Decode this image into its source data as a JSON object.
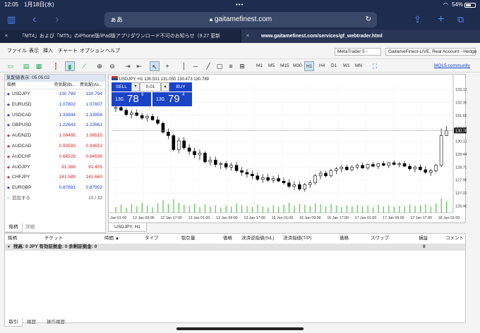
{
  "status_bar": {
    "time": "12:05",
    "date": "1月18日(水)",
    "battery": "54%"
  },
  "safari": {
    "aa": "ぁあ",
    "url": "gaitamefinest.com"
  },
  "tabs": [
    {
      "label": "「MT4」および「MT5」のiPhone版/iPad版アプリダウンロード不可のお知らせ（9.27 更新"
    },
    {
      "label": "www.gaitamefinest.com/services/gf_webtrader.html"
    }
  ],
  "menu": {
    "items": [
      "ファイル",
      "表示",
      "挿入",
      "チャート",
      "オプション",
      "ヘルプ"
    ]
  },
  "platform_select": "MetaTrader 5 -",
  "account_select": "GaitameFinest-LIVE, Real Account - Hedge",
  "toolbar": {
    "timeframes": [
      "M1",
      "M5",
      "M15",
      "M30",
      "H1",
      "H4",
      "D1",
      "W1",
      "MN"
    ],
    "active_timeframe": "H1",
    "mql5_link": "MQL5.community"
  },
  "market_watch": {
    "title": "気配値表示: 05:05:02",
    "headers": [
      "銘柄",
      "売気配(Bi...",
      "買気配(As..."
    ],
    "rows": [
      {
        "symbol": "USDJPY",
        "bid": "130.789",
        "ask": "130.794",
        "color": "#1a3fcc"
      },
      {
        "symbol": "EURUSD",
        "bid": "1.07802",
        "ask": "1.07807",
        "color": "#1a3fcc"
      },
      {
        "symbol": "USDCAD",
        "bid": "1.33944",
        "ask": "1.33956",
        "color": "#1a3fcc"
      },
      {
        "symbol": "GBPUSD",
        "bid": "1.22643",
        "ask": "1.22661",
        "color": "#1a3fcc"
      },
      {
        "symbol": "AUDNZD",
        "bid": "1.08495",
        "ask": "1.08515",
        "color": "#d62020"
      },
      {
        "symbol": "AUDCAD",
        "bid": "0.93593",
        "ask": "0.93613",
        "color": "#d62020"
      },
      {
        "symbol": "AUDCHF",
        "bid": "0.64528",
        "ask": "0.64536",
        "color": "#d62020"
      },
      {
        "symbol": "AUDJPY",
        "bid": "91.388",
        "ask": "91.405",
        "color": "#d62020"
      },
      {
        "symbol": "CHFJPY",
        "bid": "141.589",
        "ask": "141.660",
        "color": "#d62020"
      },
      {
        "symbol": "EURGBP",
        "bid": "0.87891",
        "ask": "0.87902",
        "color": "#1a3fcc"
      }
    ],
    "add_label": "追加する",
    "count": "10 / 32",
    "tabs": [
      "銘柄",
      "詳細"
    ]
  },
  "chart": {
    "header": "USDJPY, H1",
    "ohlc": "130.531 131.050 130.473 130.789",
    "tab": "USDJPY, H1",
    "trade": {
      "sell_label": "SELL",
      "buy_label": "BUY",
      "volume": "0.01",
      "sell_big": "130.",
      "sell_digits": "78",
      "sell_sup": "9",
      "buy_big": "130.",
      "buy_digits": "79",
      "buy_sup": "4"
    },
    "current_price": "130.789",
    "y_ticks": [
      "133.138",
      "132.398",
      "131.658",
      "130.918",
      "130.179",
      "129.440",
      "128.700",
      "127.961",
      "127.221",
      "126.481"
    ],
    "x_ticks": [
      "12 Jan 01:00",
      "12 Jan 09:00",
      "12 Jan 17:00",
      "13 Jan 01:00",
      "13 Jan 09:00",
      "13 Jan 17:00",
      "16 Jan 01:00",
      "16 Jan 09:00",
      "16 Jan 17:00",
      "17 Jan 01:00",
      "17 Jan 09:00",
      "17 Jan 17:00",
      "18 Jan 01:00"
    ],
    "price_range": [
      126.1,
      133.5
    ],
    "candles": [
      [
        132.05,
        132.25,
        131.85,
        132.1
      ],
      [
        132.1,
        132.3,
        131.9,
        131.95
      ],
      [
        131.95,
        132.1,
        131.6,
        131.7
      ],
      [
        131.7,
        131.95,
        131.5,
        131.8
      ],
      [
        131.8,
        132.0,
        131.6,
        131.65
      ],
      [
        131.65,
        131.8,
        131.4,
        131.5
      ],
      [
        131.5,
        131.7,
        131.3,
        131.6
      ],
      [
        131.6,
        131.75,
        131.35,
        131.4
      ],
      [
        131.4,
        131.6,
        131.1,
        131.2
      ],
      [
        131.2,
        131.3,
        130.6,
        130.7
      ],
      [
        130.7,
        130.9,
        130.3,
        130.5
      ],
      [
        130.5,
        130.6,
        129.6,
        129.7
      ],
      [
        129.7,
        130.4,
        129.5,
        130.2
      ],
      [
        130.2,
        130.4,
        129.7,
        129.8
      ],
      [
        129.8,
        130.0,
        129.4,
        129.6
      ],
      [
        129.6,
        129.8,
        129.2,
        129.4
      ],
      [
        129.4,
        129.7,
        129.1,
        129.5
      ],
      [
        129.5,
        129.6,
        128.9,
        129.0
      ],
      [
        129.0,
        129.3,
        128.8,
        129.1
      ],
      [
        129.1,
        129.3,
        128.7,
        128.85
      ],
      [
        128.85,
        129.0,
        128.6,
        128.9
      ],
      [
        128.9,
        129.05,
        128.55,
        128.7
      ],
      [
        128.7,
        128.95,
        128.5,
        128.8
      ],
      [
        128.8,
        129.0,
        128.4,
        128.5
      ],
      [
        128.5,
        128.7,
        128.2,
        128.4
      ],
      [
        128.4,
        128.6,
        128.1,
        128.3
      ],
      [
        128.3,
        128.5,
        128.0,
        128.2
      ],
      [
        128.2,
        128.4,
        127.9,
        128.0
      ],
      [
        128.0,
        128.3,
        127.8,
        128.1
      ],
      [
        128.1,
        128.3,
        127.85,
        127.95
      ],
      [
        127.95,
        128.2,
        127.8,
        128.05
      ],
      [
        128.05,
        128.25,
        127.85,
        127.9
      ],
      [
        127.9,
        128.1,
        127.7,
        127.8
      ],
      [
        127.8,
        128.0,
        127.5,
        127.6
      ],
      [
        127.6,
        127.9,
        127.4,
        127.7
      ],
      [
        127.7,
        127.9,
        127.35,
        127.45
      ],
      [
        127.45,
        127.8,
        127.3,
        127.7
      ],
      [
        127.7,
        127.95,
        127.5,
        127.8
      ],
      [
        127.8,
        128.3,
        127.7,
        128.2
      ],
      [
        128.2,
        128.5,
        128.0,
        128.35
      ],
      [
        128.35,
        128.5,
        128.1,
        128.2
      ],
      [
        128.2,
        128.6,
        128.1,
        128.5
      ],
      [
        128.5,
        128.7,
        128.3,
        128.6
      ],
      [
        128.6,
        128.8,
        128.4,
        128.7
      ],
      [
        128.7,
        128.85,
        128.5,
        128.55
      ],
      [
        128.55,
        128.8,
        128.45,
        128.7
      ],
      [
        128.7,
        128.9,
        128.55,
        128.8
      ],
      [
        128.8,
        128.95,
        128.6,
        128.65
      ],
      [
        128.65,
        128.9,
        128.55,
        128.85
      ],
      [
        128.85,
        129.0,
        128.7,
        128.75
      ],
      [
        128.75,
        128.95,
        128.6,
        128.9
      ],
      [
        128.9,
        129.05,
        128.75,
        128.8
      ],
      [
        128.8,
        129.0,
        128.65,
        128.95
      ],
      [
        128.95,
        129.1,
        128.8,
        128.85
      ],
      [
        128.85,
        129.0,
        128.7,
        128.9
      ],
      [
        128.9,
        129.05,
        128.7,
        128.75
      ],
      [
        128.75,
        128.9,
        128.5,
        128.6
      ],
      [
        128.6,
        128.8,
        128.4,
        128.7
      ],
      [
        128.7,
        128.85,
        128.5,
        128.55
      ],
      [
        128.55,
        128.75,
        128.3,
        128.4
      ],
      [
        128.4,
        128.6,
        128.2,
        128.5
      ],
      [
        128.5,
        128.9,
        128.4,
        128.8
      ],
      [
        128.8,
        130.9,
        128.7,
        130.5
      ],
      [
        130.5,
        131.05,
        130.47,
        130.789
      ]
    ],
    "volumes": [
      40,
      55,
      35,
      60,
      45,
      70,
      50,
      38,
      65,
      90,
      60,
      95,
      70,
      55,
      48,
      62,
      40,
      58,
      44,
      52,
      36,
      48,
      42,
      66,
      50,
      46,
      40,
      58,
      44,
      38,
      50,
      42,
      56,
      70,
      48,
      60,
      54,
      46,
      68,
      58,
      44,
      62,
      50,
      40,
      52,
      46,
      56,
      42,
      48,
      38,
      54,
      44,
      50,
      40,
      46,
      42,
      58,
      48,
      52,
      60,
      44,
      66,
      100,
      80
    ]
  },
  "terminal": {
    "headers": [
      "銘柄",
      "チケット",
      "時間 ▲",
      "タイプ",
      "取引量",
      "価格",
      "決済逆指値(S/L)",
      "決済指値(T/P)",
      "価格",
      "スワップ",
      "損益",
      "コメント"
    ],
    "balance_row": "残高: 0 JPY  有効証拠金: 0  余剰証拠金: 0",
    "balance_pl": "0",
    "tabs": [
      "取引",
      "履歴",
      "操作履歴"
    ]
  }
}
